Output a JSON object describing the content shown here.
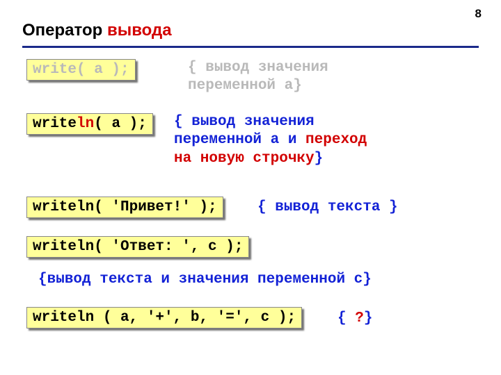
{
  "page_number": "8",
  "title": {
    "part1": "Оператор ",
    "part2": "вывода"
  },
  "items": [
    {
      "code": {
        "full": "write( a );",
        "muted": true
      },
      "comment": {
        "open": "{ ",
        "blue1": "вывод значения",
        "blue2": "переменной a",
        "close": "}",
        "muted": true
      }
    },
    {
      "code": {
        "pre": "write",
        "red": "ln",
        "post": "( a );"
      },
      "comment": {
        "open": "{ ",
        "blue1": "вывод значения",
        "blue2": "переменной a и ",
        "red": "переход",
        "red2": "на новую строчку",
        "close": "}"
      }
    },
    {
      "code": {
        "full": "writeln( 'Привет!' );"
      },
      "comment": {
        "open": "{ ",
        "blue": "вывод текста ",
        "close": "}"
      }
    },
    {
      "code": {
        "full": "writeln( 'Ответ: ', c );"
      },
      "comment": {
        "open": "{",
        "blue": "вывод текста и значения переменной c",
        "close": "}"
      }
    },
    {
      "code": {
        "full": "writeln ( a, '+', b, '=', c );"
      },
      "comment": {
        "open": "{ ",
        "red": "?",
        "close": "}"
      }
    }
  ]
}
